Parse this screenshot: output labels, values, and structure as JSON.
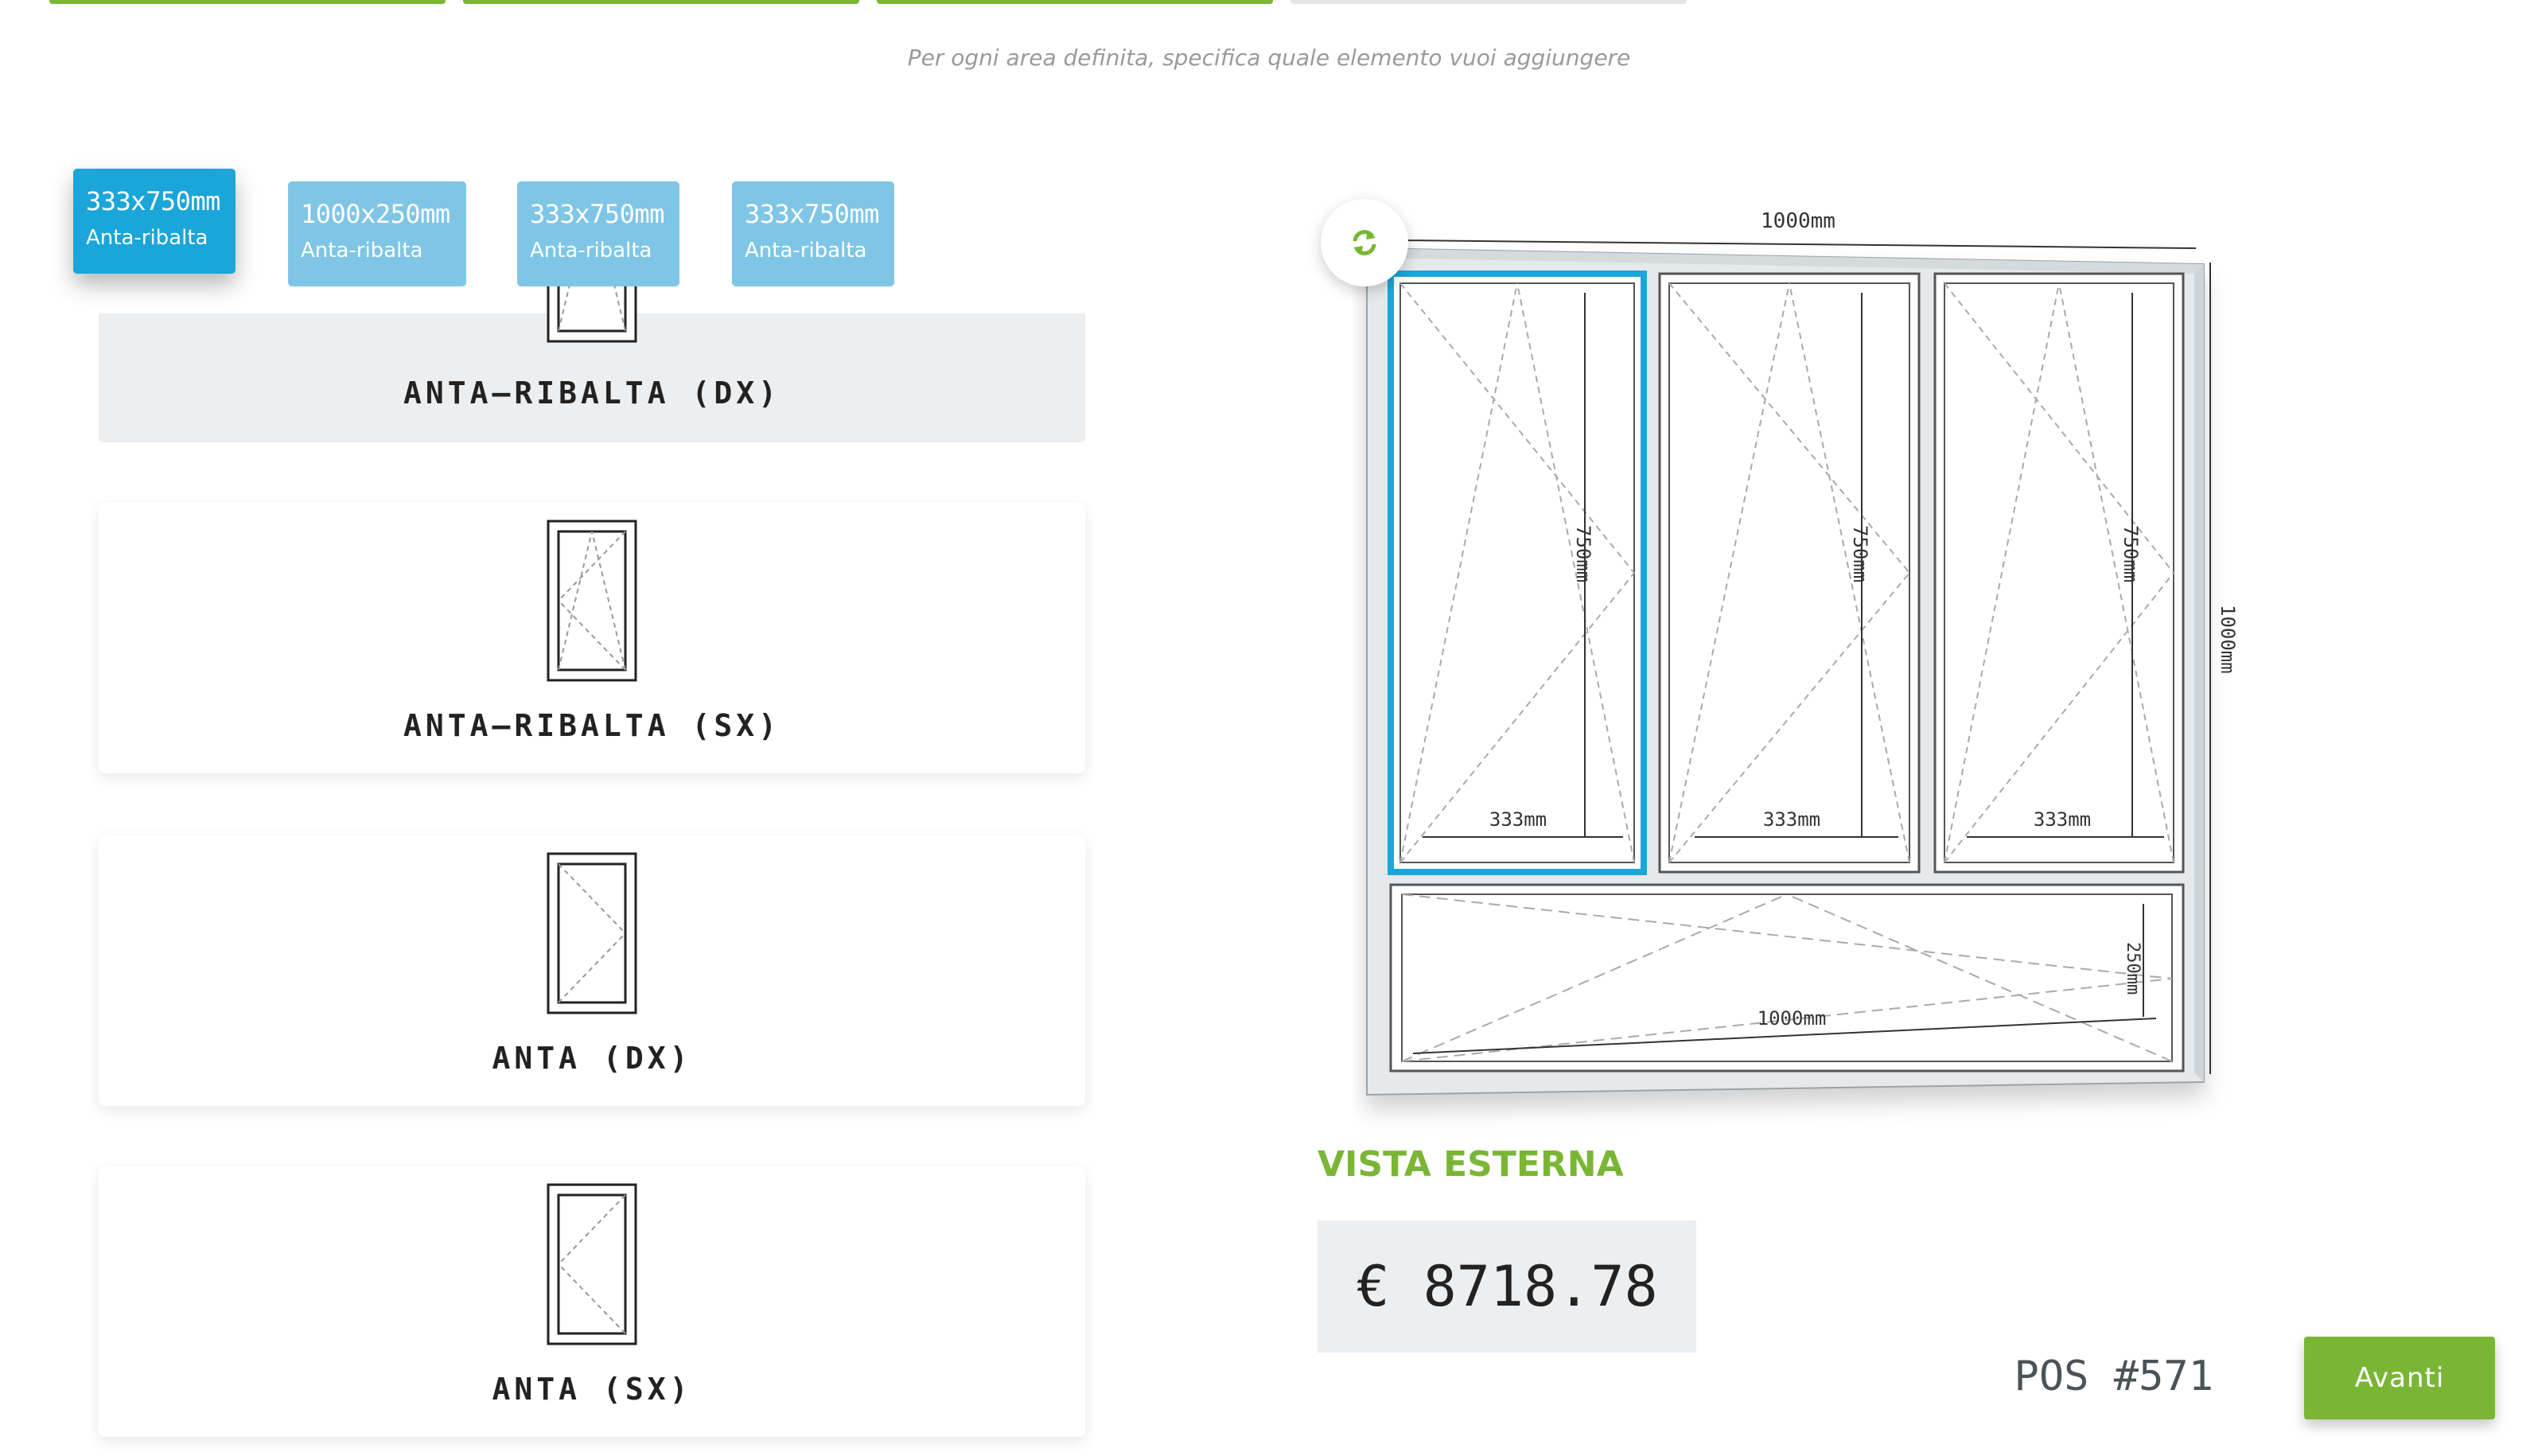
{
  "steps_progress": [
    {
      "color": "#7ab635",
      "complete": true
    },
    {
      "color": "#7ab635",
      "complete": true
    },
    {
      "color": "#7ab635",
      "complete": true
    },
    {
      "color": "#e3e5e7",
      "complete": false
    }
  ],
  "hint": "Per ogni area definita, specifica quale elemento vuoi aggiungere",
  "area_tabs": [
    {
      "dim": "333x750mm",
      "type": "Anta-ribalta",
      "active": true
    },
    {
      "dim": "1000x250mm",
      "type": "Anta-ribalta",
      "active": false
    },
    {
      "dim": "333x750mm",
      "type": "Anta-ribalta",
      "active": false
    },
    {
      "dim": "333x750mm",
      "type": "Anta-ribalta",
      "active": false
    }
  ],
  "element_options": [
    {
      "label": "ANTA–RIBALTA (DX)",
      "selected": true
    },
    {
      "label": "ANTA–RIBALTA (SX)",
      "selected": false
    },
    {
      "label": "ANTA (DX)",
      "selected": false
    },
    {
      "label": "ANTA (SX)",
      "selected": false
    }
  ],
  "window_preview": {
    "total_width_label": "1000mm",
    "total_height_label": "1000mm",
    "top_panes": [
      {
        "width_label": "333mm",
        "height_label": "750mm",
        "highlighted": true
      },
      {
        "width_label": "333mm",
        "height_label": "750mm",
        "highlighted": false
      },
      {
        "width_label": "333mm",
        "height_label": "750mm",
        "highlighted": false
      }
    ],
    "bottom_pane": {
      "width_label": "1000mm",
      "height_label": "250mm"
    }
  },
  "view_label": "VISTA ESTERNA",
  "price": "€ 8718.78",
  "position": "POS #571",
  "next_button": "Avanti",
  "colors": {
    "accent_green": "#7ab635",
    "accent_blue": "#1ba6da",
    "tab_blue": "#7fc6e6",
    "panel_grey": "#eceef0"
  },
  "icons": {
    "refresh": "refresh-icon"
  }
}
